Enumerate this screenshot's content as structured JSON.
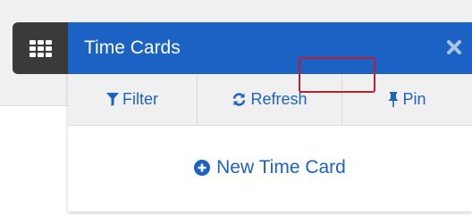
{
  "launcher": {
    "icon": "grid-icon"
  },
  "panel": {
    "title": "Time Cards",
    "close_icon": "close-icon"
  },
  "toolbar": {
    "filter_label": "Filter",
    "filter_icon": "filter-icon",
    "refresh_label": "Refresh",
    "refresh_icon": "refresh-icon",
    "pin_label": "Pin",
    "pin_icon": "pin-icon"
  },
  "actions": {
    "new_label": "New Time Card",
    "new_icon": "plus-circle-icon"
  },
  "colors": {
    "header_blue": "#1c62c4",
    "launcher_dark": "#3a3a3a",
    "toolbar_gray": "#f0f0f0",
    "highlight_red": "#b8202a"
  }
}
